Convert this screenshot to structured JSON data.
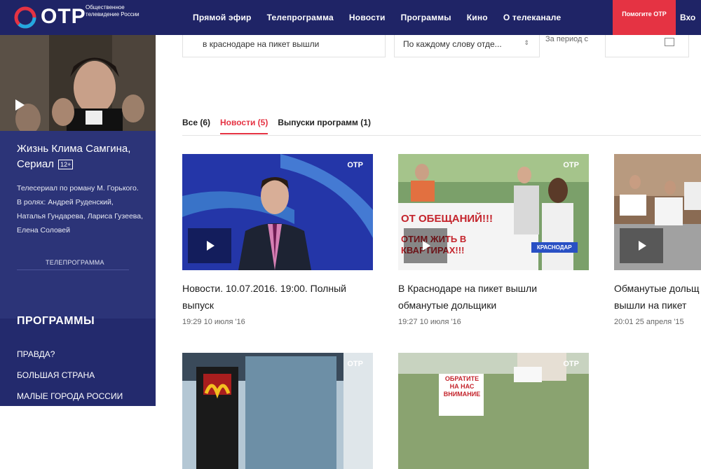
{
  "header": {
    "logo_text": "ОТР",
    "logo_sub": "Общественное телевидение России",
    "nav": [
      "Прямой эфир",
      "Телепрограмма",
      "Новости",
      "Программы",
      "Кино",
      "О телеканале"
    ],
    "help_label": "Помогите ОТР",
    "enter_label": "Вхо"
  },
  "sidebar": {
    "show_title": "Жизнь Клима Самгина, Сериал",
    "age_badge": "12+",
    "description": "Телесериал по роману М. Горького. В ролях: Андрей Руденский, Наталья Гундарева, Лариса Гузеева, Елена Соловей",
    "tv_link": "ТЕЛЕПРОГРАММА",
    "programs_heading": "ПРОГРАММЫ",
    "programs": [
      "ПРАВДА?",
      "БОЛЬШАЯ СТРАНА",
      "МАЛЫЕ ГОРОДА РОССИИ"
    ]
  },
  "search": {
    "query": "в краснодаре на пикет вышли",
    "mode": "По каждому слову отде...",
    "period_label": "За период с"
  },
  "tabs": [
    {
      "label": "Все (6)"
    },
    {
      "label": "Новости (5)"
    },
    {
      "label": "Выпуски программ (1)"
    }
  ],
  "cards": [
    {
      "title": "Новости. 10.07.2016. 19:00. Полный выпуск",
      "date": "19:29 10 июля '16",
      "badge": "ОТР"
    },
    {
      "title": "В Краснодаре на пикет вышли обманутые дольщики",
      "date": "19:27 10 июля '16",
      "badge": "ОТР",
      "banner1": "ОТ ОБЕЩАНИЙ!!!",
      "banner2": "ОТИМ ЖИТЬ В КВАРТИРАХ!!!",
      "tag": "КРАСНОДАР"
    },
    {
      "title": "Обманутые дольщ вышли на пикет",
      "date": "20:01 25 апреля '15"
    },
    {
      "badge": "ОТР"
    },
    {
      "badge": "ОТР",
      "sign": "ОБРАТИТЕ НА НАС ВНИМАНИЕ"
    }
  ],
  "colors": {
    "navy": "#1f2466",
    "accent": "#e53343",
    "sidebar": "#232a6d"
  }
}
